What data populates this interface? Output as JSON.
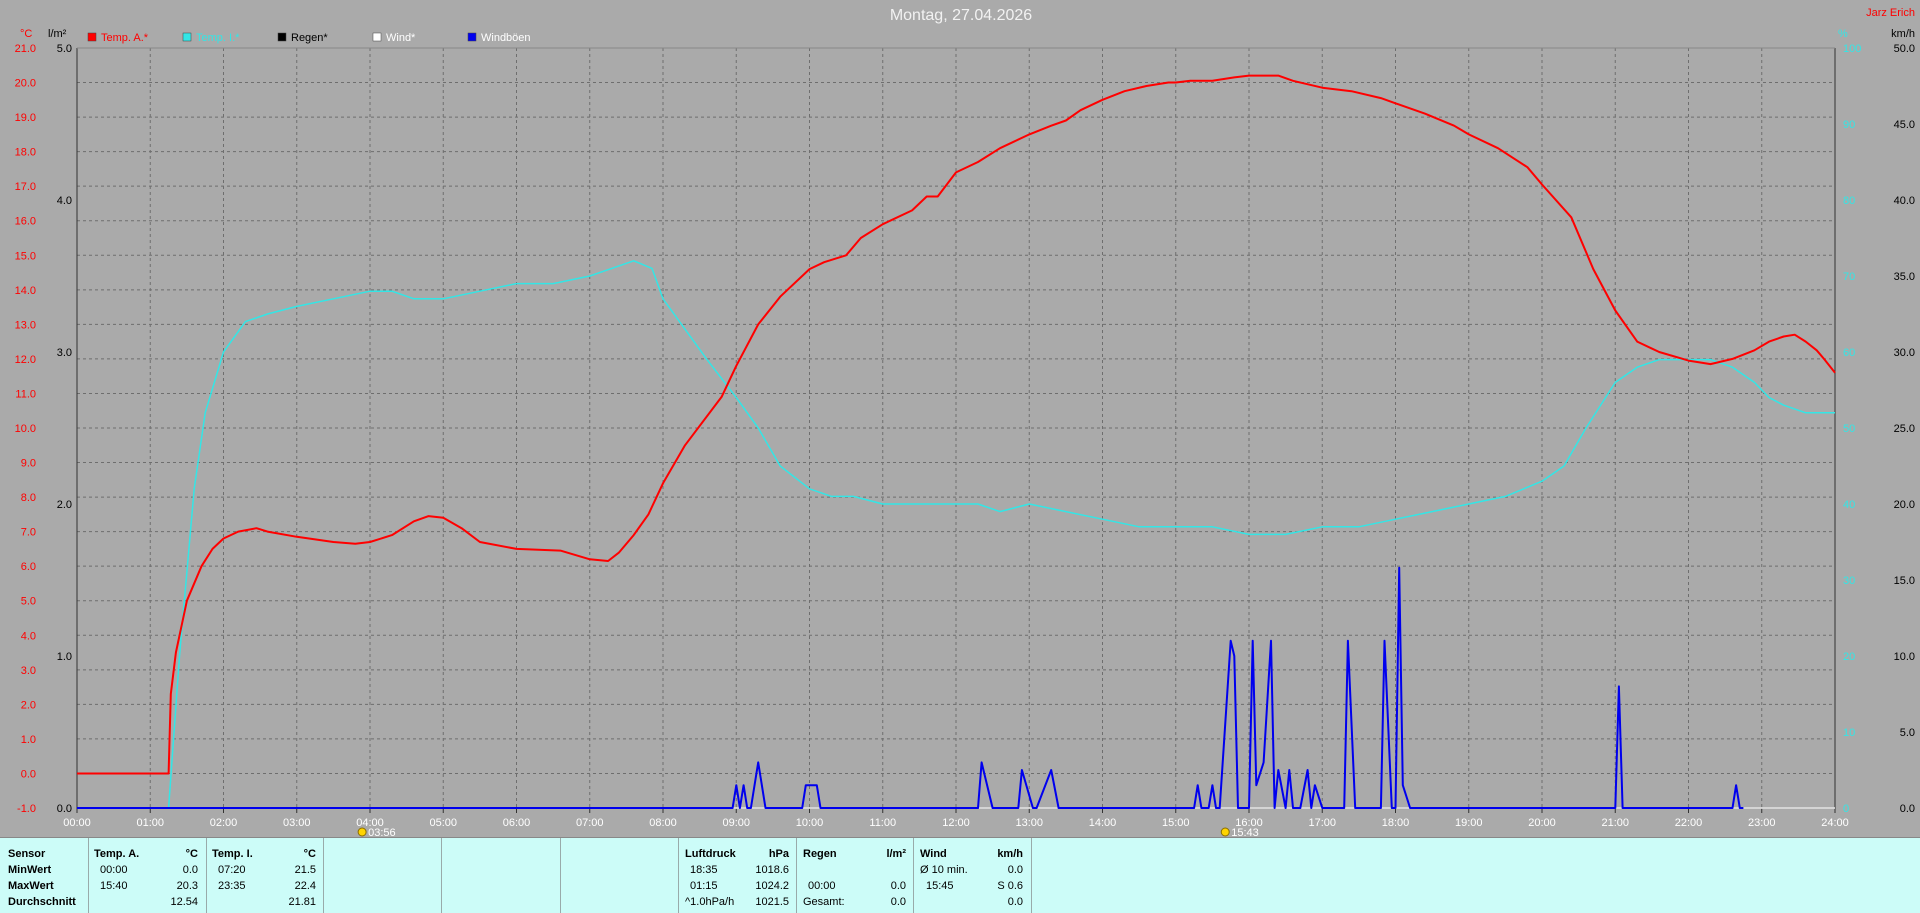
{
  "title": "Montag, 27.04.2026",
  "station": "Jarz Erich",
  "colors": {
    "temp": "#ff0000",
    "inner": "#33e6e6",
    "rain": "#000000",
    "wind": "#ffffff",
    "gust": "#0000ee",
    "plot_bg": "#aaaaaa",
    "grid": "#6e6e6e",
    "stats_bg": "#ccfcf8"
  },
  "axes": {
    "left_unit": "°C",
    "rain_unit": "l/m²",
    "right_unit": "km/h",
    "right_top_label": "%",
    "temp_ticks": [
      "21.0",
      "20.0",
      "19.0",
      "18.0",
      "17.0",
      "16.0",
      "15.0",
      "14.0",
      "13.0",
      "12.0",
      "11.0",
      "10.0",
      "9.0",
      "8.0",
      "7.0",
      "6.0",
      "5.0",
      "4.0",
      "3.0",
      "2.0",
      "1.0",
      "0.0",
      "-1.0"
    ],
    "rain_ticks": [
      "5.0",
      "4.0",
      "3.0",
      "2.0",
      "1.0",
      "0.0"
    ],
    "hum_ticks": [
      "100",
      "90",
      "80",
      "70",
      "60",
      "50",
      "40",
      "30",
      "20",
      "10",
      "0"
    ],
    "wind_ticks": [
      "50.0",
      "45.0",
      "40.0",
      "35.0",
      "30.0",
      "25.0",
      "20.0",
      "15.0",
      "10.0",
      "5.0",
      "0.0"
    ],
    "time_ticks": [
      "00:00",
      "01:00",
      "02:00",
      "03:00",
      "04:00",
      "05:00",
      "06:00",
      "07:00",
      "08:00",
      "09:00",
      "10:00",
      "11:00",
      "12:00",
      "13:00",
      "14:00",
      "15:00",
      "16:00",
      "17:00",
      "18:00",
      "19:00",
      "20:00",
      "21:00",
      "22:00",
      "23:00",
      "24:00"
    ],
    "sunrise": "03:56",
    "sunset": "15:43"
  },
  "chart_data": {
    "type": "line",
    "title": "Montag, 27.04.2026",
    "x_unit": "hours",
    "xlim": [
      0,
      24
    ],
    "ylim_temp": [
      -1,
      21
    ],
    "ylim_wind": [
      0,
      50
    ],
    "grid": true,
    "legend_position": "top",
    "series": [
      {
        "name": "Temp. A.*",
        "axis": "temp",
        "color": "#ff0000",
        "x": [
          0,
          1.0,
          1.25,
          1.28,
          1.35,
          1.5,
          1.7,
          1.85,
          2.0,
          2.2,
          2.45,
          2.6,
          3.0,
          3.5,
          3.8,
          4.0,
          4.3,
          4.6,
          4.8,
          5.0,
          5.25,
          5.5,
          6.0,
          6.6,
          7.0,
          7.25,
          7.4,
          7.6,
          7.8,
          8.0,
          8.3,
          8.8,
          9.0,
          9.3,
          9.6,
          10.0,
          10.2,
          10.5,
          10.7,
          11.0,
          11.4,
          11.6,
          11.75,
          12.0,
          12.3,
          12.6,
          12.8,
          13.0,
          13.3,
          13.5,
          13.7,
          14.0,
          14.3,
          14.6,
          14.9,
          15.0,
          15.2,
          15.5,
          15.8,
          16.0,
          16.1,
          16.4,
          16.6,
          17.0,
          17.4,
          17.8,
          18.0,
          18.4,
          18.8,
          19.0,
          19.4,
          19.8,
          20.0,
          20.4,
          20.7,
          21.0,
          21.3,
          21.6,
          22.0,
          22.3,
          22.6,
          22.9,
          23.1,
          23.3,
          23.45,
          23.6,
          23.75,
          23.85,
          24.0
        ],
        "values": [
          0.0,
          0.0,
          0.0,
          2.3,
          3.5,
          5.0,
          6.0,
          6.5,
          6.8,
          7.0,
          7.1,
          7.0,
          6.85,
          6.7,
          6.65,
          6.7,
          6.9,
          7.3,
          7.45,
          7.4,
          7.1,
          6.7,
          6.5,
          6.45,
          6.2,
          6.15,
          6.4,
          6.9,
          7.5,
          8.4,
          9.5,
          10.9,
          11.8,
          13.0,
          13.8,
          14.6,
          14.8,
          15.0,
          15.5,
          15.9,
          16.3,
          16.7,
          16.7,
          17.4,
          17.7,
          18.1,
          18.3,
          18.5,
          18.75,
          18.9,
          19.2,
          19.5,
          19.75,
          19.9,
          20.0,
          20.0,
          20.05,
          20.05,
          20.15,
          20.2,
          20.2,
          20.2,
          20.05,
          19.85,
          19.75,
          19.55,
          19.4,
          19.1,
          18.75,
          18.5,
          18.1,
          17.55,
          17.05,
          16.1,
          14.6,
          13.4,
          12.5,
          12.2,
          11.95,
          11.85,
          12.0,
          12.25,
          12.5,
          12.65,
          12.7,
          12.5,
          12.25,
          12.0,
          11.6
        ]
      },
      {
        "name": "Temp. I.*",
        "axis": "hum",
        "color": "#33e6e6",
        "x": [
          1.25,
          1.4,
          1.6,
          1.75,
          2.0,
          2.3,
          2.6,
          3.0,
          3.5,
          4.0,
          4.3,
          4.6,
          5.0,
          5.5,
          6.0,
          6.5,
          7.0,
          7.3,
          7.6,
          7.85,
          8.0,
          8.3,
          8.6,
          9.0,
          9.3,
          9.6,
          10.0,
          10.3,
          10.6,
          11.0,
          11.5,
          12.0,
          12.3,
          12.6,
          13.0,
          13.5,
          14.0,
          14.5,
          15.0,
          15.5,
          16.0,
          16.5,
          17.0,
          17.5,
          18.0,
          18.5,
          19.0,
          19.5,
          20.0,
          20.3,
          20.6,
          21.0,
          21.3,
          21.6,
          22.0,
          22.3,
          22.6,
          22.9,
          23.1,
          23.3,
          23.6,
          23.85,
          24.0
        ],
        "values": [
          0,
          20,
          42,
          52,
          60,
          64,
          65,
          66,
          67,
          68,
          68,
          67,
          67,
          68,
          69,
          69,
          70,
          71,
          72,
          71,
          67,
          63,
          59,
          54,
          50,
          45,
          42,
          41,
          41,
          40,
          40,
          40,
          40,
          39,
          40,
          39,
          38,
          37,
          37,
          37,
          36,
          36,
          37,
          37,
          38,
          39,
          40,
          41,
          43,
          45,
          50,
          56,
          58,
          59,
          59,
          59,
          58,
          56,
          54,
          53,
          52,
          52,
          52
        ]
      },
      {
        "name": "Windböen",
        "axis": "wind",
        "color": "#0000ee",
        "x": [
          0,
          8.9,
          8.95,
          9.0,
          9.05,
          9.1,
          9.15,
          9.2,
          9.3,
          9.4,
          9.45,
          9.5,
          9.6,
          9.9,
          9.95,
          10.1,
          10.15,
          10.2,
          12.3,
          12.35,
          12.5,
          12.55,
          12.85,
          12.9,
          13.05,
          13.1,
          13.3,
          13.4,
          13.5,
          13.55,
          14.5,
          15.2,
          15.25,
          15.3,
          15.35,
          15.45,
          15.5,
          15.55,
          15.6,
          15.75,
          15.8,
          15.85,
          15.9,
          16.0,
          16.05,
          16.1,
          16.2,
          16.3,
          16.35,
          16.4,
          16.5,
          16.55,
          16.6,
          16.7,
          16.8,
          16.85,
          16.9,
          17.0,
          17.05,
          17.1,
          17.2,
          17.3,
          17.35,
          17.45,
          17.5,
          17.8,
          17.85,
          17.95,
          18.0,
          18.05,
          18.1,
          18.2,
          18.25,
          18.3,
          21.0,
          21.05,
          21.1,
          21.15,
          21.25,
          21.3,
          22.6,
          22.65,
          22.7,
          22.75
        ],
        "values": [
          0,
          0,
          0,
          1.5,
          0,
          1.5,
          0,
          0,
          3.0,
          0,
          0,
          0,
          0,
          0,
          1.5,
          1.5,
          0,
          0,
          0,
          3.0,
          0,
          0,
          0,
          2.5,
          0,
          0,
          2.5,
          0,
          0,
          0,
          0,
          0,
          0,
          1.5,
          0,
          0,
          1.5,
          0,
          0,
          11.0,
          10.0,
          0,
          0,
          0,
          11.0,
          1.5,
          3.0,
          11.0,
          0,
          2.5,
          0,
          2.5,
          0,
          0,
          2.5,
          0,
          1.5,
          0,
          0,
          0,
          0,
          0,
          11.0,
          0,
          0,
          0,
          11.0,
          0,
          0,
          15.8,
          1.5,
          0,
          0,
          0,
          0,
          8.0,
          0,
          0,
          0,
          0,
          0,
          1.5,
          0,
          0
        ]
      },
      {
        "name": "Regen*",
        "axis": "rain",
        "color": "#000000",
        "x": [
          0,
          24
        ],
        "values": [
          0,
          0
        ]
      },
      {
        "name": "Wind*",
        "axis": "wind",
        "color": "#ffffff",
        "x": [
          0,
          24
        ],
        "values": [
          0,
          0
        ]
      }
    ]
  },
  "stats": {
    "row_labels": {
      "header": "Sensor",
      "min": "MinWert",
      "max": "MaxWert",
      "avg": "Durchschnitt"
    },
    "temp_a": {
      "header": "Temp. A.",
      "unit": "°C",
      "min_time": "00:00",
      "min": "0.0",
      "max_time": "15:40",
      "max": "20.3",
      "avg": "12.54"
    },
    "temp_i": {
      "header": "Temp. I.",
      "unit": "°C",
      "min_time": "07:20",
      "min": "21.5",
      "max_time": "23:35",
      "max": "22.4",
      "avg": "21.81"
    },
    "pressure": {
      "header": "Luftdruck",
      "unit": "hPa",
      "min_time": "18:35",
      "min": "1018.6",
      "max_time": "01:15",
      "max": "1024.2",
      "avg_label": "^1.0hPa/h",
      "avg": "1021.5"
    },
    "rain": {
      "header": "Regen",
      "unit": "l/m²",
      "time": "00:00",
      "value": "0.0",
      "total_label": "Gesamt:",
      "total": "0.0"
    },
    "wind": {
      "header": "Wind",
      "unit": "km/h",
      "avg10_label": "Ø 10 min.",
      "avg10": "0.0",
      "max_time": "15:45",
      "max": "S 0.6",
      "avg": "0.0"
    }
  }
}
